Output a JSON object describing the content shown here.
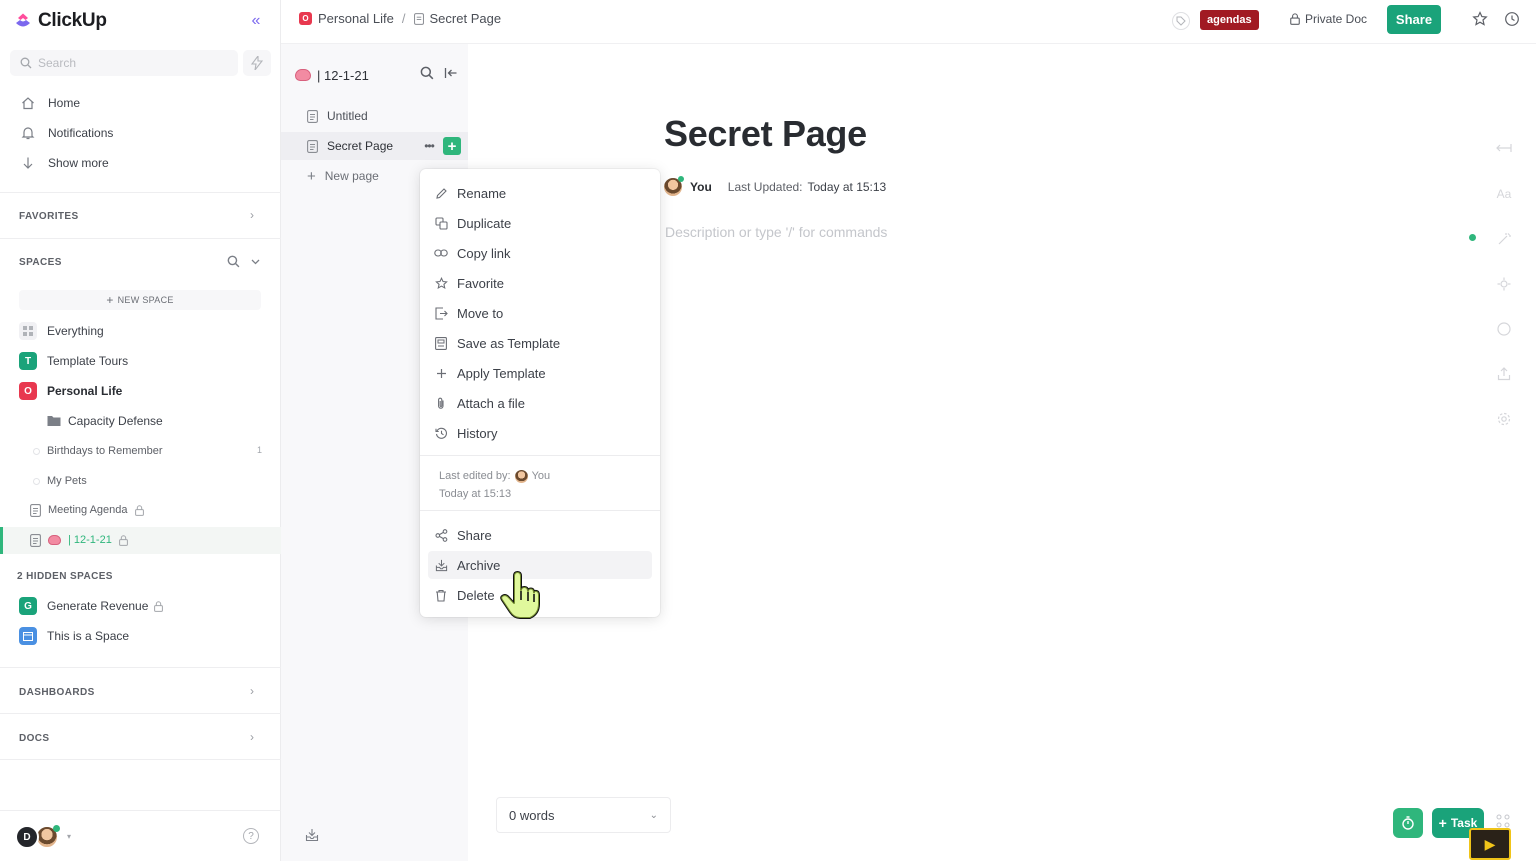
{
  "app": {
    "name": "ClickUp"
  },
  "sidebar": {
    "search_placeholder": "Search",
    "nav": [
      {
        "label": "Home",
        "icon": "home-icon"
      },
      {
        "label": "Notifications",
        "icon": "bell-icon"
      },
      {
        "label": "Show more",
        "icon": "arrow-down-icon"
      }
    ],
    "favorites_label": "FAVORITES",
    "spaces_label": "SPACES",
    "new_space_label": "NEW SPACE",
    "spaces": [
      {
        "label": "Everything",
        "icon": "grid-icon"
      },
      {
        "label": "Template Tours",
        "badge": "T",
        "color": "#1aa37a"
      },
      {
        "label": "Personal Life",
        "badge": "O",
        "color": "#e8384f"
      }
    ],
    "personal_children": [
      {
        "label": "Capacity Defense",
        "icon": "folder-icon"
      },
      {
        "label": "Birthdays to Remember",
        "count": "1"
      },
      {
        "label": "My Pets"
      },
      {
        "label": "Meeting Agenda",
        "icon": "doc-icon",
        "locked": true
      },
      {
        "label": "| 12-1-21",
        "icon": "doc-icon",
        "locked": true
      }
    ],
    "hidden_spaces_label": "2 HIDDEN SPACES",
    "hidden_spaces": [
      {
        "label": "Generate Revenue",
        "badge": "G",
        "color": "#1aa37a",
        "locked": true
      },
      {
        "label": "This is a Space",
        "icon": "calendar-icon",
        "color": "#4a90e2"
      }
    ],
    "dashboards_label": "DASHBOARDS",
    "docs_label": "DOCS",
    "user_initial": "D"
  },
  "breadcrumb": {
    "space": "Personal Life",
    "separator": "/",
    "page": "Secret Page",
    "space_badge": "O"
  },
  "topbar": {
    "tag": "agendas",
    "tag_color": "#a11a23",
    "privacy": "Private Doc",
    "share_label": "Share"
  },
  "pages_panel": {
    "doc_title": "| 12-1-21",
    "pages": [
      {
        "label": "Untitled"
      },
      {
        "label": "Secret Page"
      }
    ],
    "new_page_label": "New page"
  },
  "document": {
    "title": "Secret Page",
    "author": "You",
    "updated_label": "Last Updated:",
    "updated_value": "Today at 15:13",
    "placeholder": "Description or type '/' for commands",
    "word_count": "0 words"
  },
  "context_menu": {
    "items": [
      {
        "label": "Rename",
        "icon": "pencil-icon"
      },
      {
        "label": "Duplicate",
        "icon": "duplicate-icon"
      },
      {
        "label": "Copy link",
        "icon": "link-icon"
      },
      {
        "label": "Favorite",
        "icon": "star-icon"
      },
      {
        "label": "Move to",
        "icon": "move-icon"
      },
      {
        "label": "Save as Template",
        "icon": "template-icon"
      },
      {
        "label": "Apply Template",
        "icon": "plus-icon"
      },
      {
        "label": "Attach a file",
        "icon": "paperclip-icon"
      },
      {
        "label": "History",
        "icon": "history-icon"
      }
    ],
    "last_edited_label": "Last edited by:",
    "last_edited_user": "You",
    "last_edited_time": "Today at 15:13",
    "bottom_items": [
      {
        "label": "Share",
        "icon": "share-icon"
      },
      {
        "label": "Archive",
        "icon": "archive-icon"
      },
      {
        "label": "Delete",
        "icon": "trash-icon"
      }
    ]
  },
  "fab": {
    "task_label": "Task"
  },
  "colors": {
    "brand_green": "#1aa37a",
    "accent_green": "#2fb67c",
    "brand_purple": "#7b68ee"
  }
}
